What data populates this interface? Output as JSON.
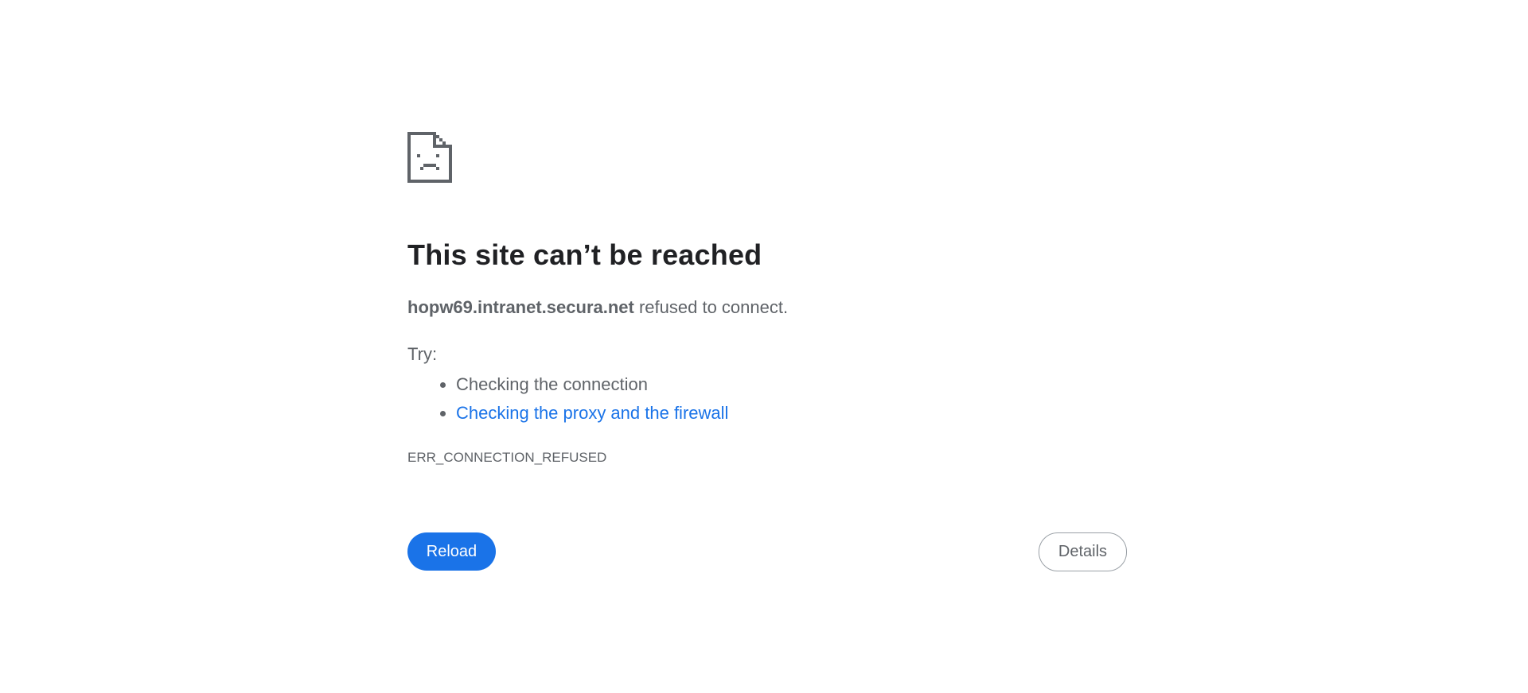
{
  "icon": {
    "name": "sad-page-icon",
    "color": "#5f6368"
  },
  "title": "This site can’t be reached",
  "summary": {
    "host": "hopw69.intranet.secura.net",
    "message": " refused to connect."
  },
  "try_label": "Try:",
  "suggestions": [
    {
      "label": "Checking the connection",
      "is_link": false
    },
    {
      "label": "Checking the proxy and the firewall",
      "is_link": true
    }
  ],
  "error_code": "ERR_CONNECTION_REFUSED",
  "buttons": {
    "reload_label": "Reload",
    "details_label": "Details"
  },
  "colors": {
    "accent": "#1a73e8",
    "text": "#5f6368",
    "heading": "#202124"
  }
}
